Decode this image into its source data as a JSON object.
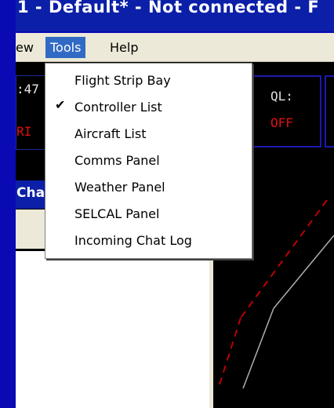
{
  "window": {
    "title": "1 - Default* - Not connected - F"
  },
  "menubar": {
    "items": [
      {
        "label": "ew"
      },
      {
        "label": "Tools"
      },
      {
        "label": "Help"
      }
    ]
  },
  "tools_menu": {
    "items": [
      {
        "label": "Flight Strip Bay",
        "checked": false
      },
      {
        "label": "Controller List",
        "checked": true,
        "check_glyph": "✔"
      },
      {
        "label": "Aircraft List",
        "checked": false
      },
      {
        "label": "Comms Panel",
        "checked": false
      },
      {
        "label": "Weather Panel",
        "checked": false
      },
      {
        "label": "SELCAL Panel",
        "checked": false
      },
      {
        "label": "Incoming Chat Log",
        "checked": false
      }
    ]
  },
  "status": {
    "time_fragment": ":47",
    "red_fragment": "RI",
    "ql_label": "QL:",
    "ql_value": "OFF"
  },
  "chat": {
    "tab_fragment": "Cha"
  },
  "colors": {
    "desktop": "#0a0ab5",
    "menu_highlight": "#316ac5",
    "radar_red": "#c00000",
    "radar_line": "#b0b0b0",
    "status_red": "#e01010"
  }
}
